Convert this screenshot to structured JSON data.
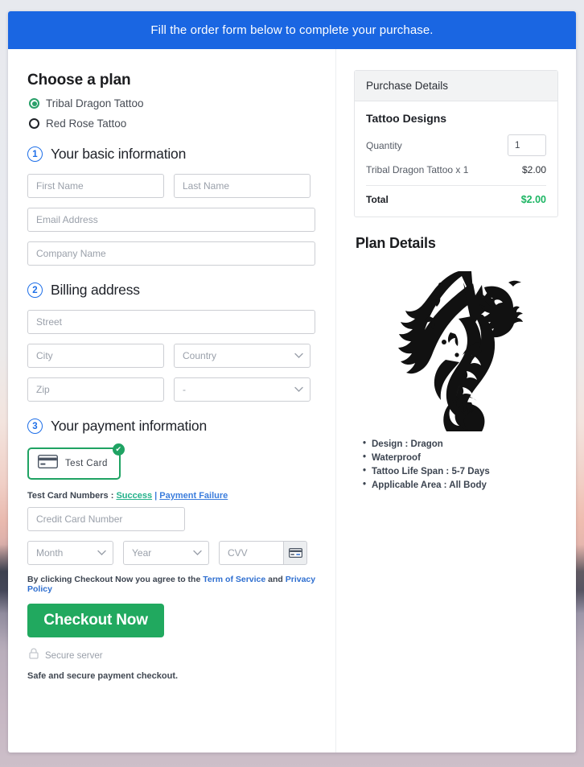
{
  "banner": {
    "text": "Fill the order form below to complete your purchase."
  },
  "plan": {
    "heading": "Choose a plan",
    "options": [
      {
        "label": "Tribal Dragon Tattoo",
        "selected": true
      },
      {
        "label": "Red Rose Tattoo",
        "selected": false
      }
    ]
  },
  "step1": {
    "number": "1",
    "title": "Your basic information",
    "fields": {
      "first_name": {
        "placeholder": "First Name",
        "value": ""
      },
      "last_name": {
        "placeholder": "Last Name",
        "value": ""
      },
      "email": {
        "placeholder": "Email Address",
        "value": ""
      },
      "company": {
        "placeholder": "Company Name",
        "value": ""
      }
    }
  },
  "step2": {
    "number": "2",
    "title": "Billing address",
    "fields": {
      "street": {
        "placeholder": "Street",
        "value": ""
      },
      "city": {
        "placeholder": "City",
        "value": ""
      },
      "country": {
        "placeholder": "Country",
        "value": "Country"
      },
      "zip": {
        "placeholder": "Zip",
        "value": ""
      },
      "state": {
        "placeholder": "-",
        "value": "-"
      }
    }
  },
  "step3": {
    "number": "3",
    "title": "Your payment information",
    "method": {
      "label": "Test  Card",
      "selected": true,
      "icon": "credit-card-icon",
      "check": "✔"
    },
    "test_cards": {
      "prefix": "Test Card Numbers : ",
      "success": "Success",
      "separator": " | ",
      "failure": "Payment Failure"
    },
    "fields": {
      "card_number": {
        "placeholder": "Credit Card Number",
        "value": ""
      },
      "month": {
        "placeholder": "Month",
        "value": "Month"
      },
      "year": {
        "placeholder": "Year",
        "value": "Year"
      },
      "cvv": {
        "placeholder": "CVV",
        "value": ""
      }
    }
  },
  "footer": {
    "agree_prefix": "By clicking Checkout Now you agree to the ",
    "terms_link": "Term of Service",
    "agree_mid": " and ",
    "privacy_link": "Privacy Policy",
    "checkout_label": "Checkout Now",
    "secure_server": "Secure server",
    "safe_note": "Safe and secure payment checkout."
  },
  "purchase": {
    "header": "Purchase Details",
    "product_title": "Tattoo Designs",
    "quantity_label": "Quantity",
    "quantity_value": "1",
    "line_item_label": "Tribal Dragon Tattoo x 1",
    "line_item_price": "$2.00",
    "total_label": "Total",
    "total_price": "$2.00"
  },
  "plan_details": {
    "title": "Plan Details",
    "image_alt": "tribal-dragon-tattoo-illustration",
    "features": [
      "Design : Dragon",
      "Waterproof",
      "Tattoo Life Span : 5-7 Days",
      "Applicable Area : All Body"
    ]
  },
  "colors": {
    "banner_blue": "#1a66e2",
    "accent_green": "#21a95f",
    "total_green": "#1cb563",
    "step_blue": "#1e6fe8",
    "link_blue": "#2f6fd0",
    "success_link": "#23b18a"
  }
}
